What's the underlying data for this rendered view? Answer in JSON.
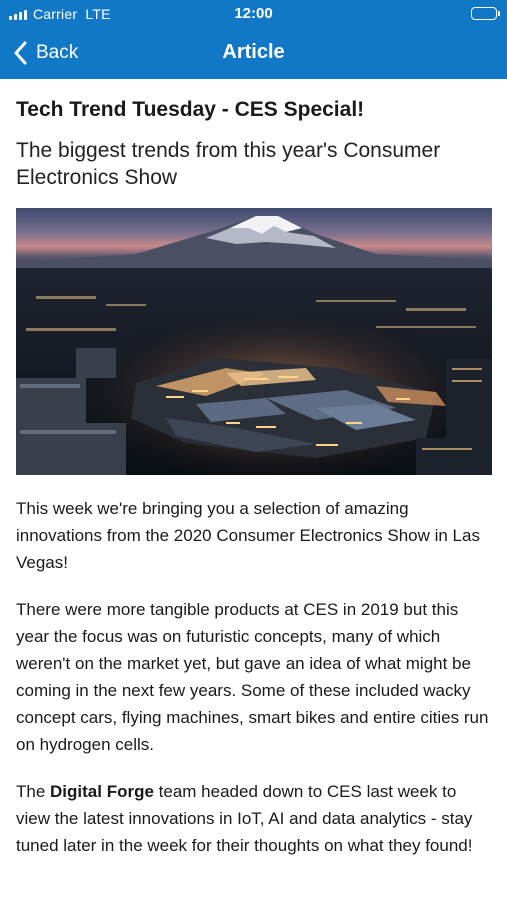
{
  "status_bar": {
    "carrier": "Carrier",
    "network": "LTE",
    "time": "12:00",
    "signal_icon": "cellular-signal-icon",
    "battery_icon": "battery-full-icon"
  },
  "nav": {
    "back_label": "Back",
    "back_icon": "chevron-left-icon",
    "title": "Article",
    "background_color": "#1178c8"
  },
  "article": {
    "title": "Tech Trend Tuesday - CES Special!",
    "subtitle": "The biggest trends from this year's Consumer Electronics Show",
    "hero_image": "city-at-night-with-snow-capped-mountain",
    "paragraph_1": "This week we're bringing you a selection of amazing innovations from the 2020 Consumer Electronics Show in Las Vegas!",
    "paragraph_2": "There were more tangible products at CES in 2019 but this year the focus was on futuristic concepts, many of which weren't on the market yet, but gave an idea of what might be coming in the next few years. Some of these included wacky concept cars, flying machines, smart bikes and entire cities run on hydrogen cells.",
    "paragraph_3": {
      "before": "The ",
      "emphasis": "Digital Forge",
      "after": " team headed down to CES last week to view the latest innovations in IoT, AI and data analytics - stay tuned later in the week for their thoughts on what they found!"
    }
  }
}
